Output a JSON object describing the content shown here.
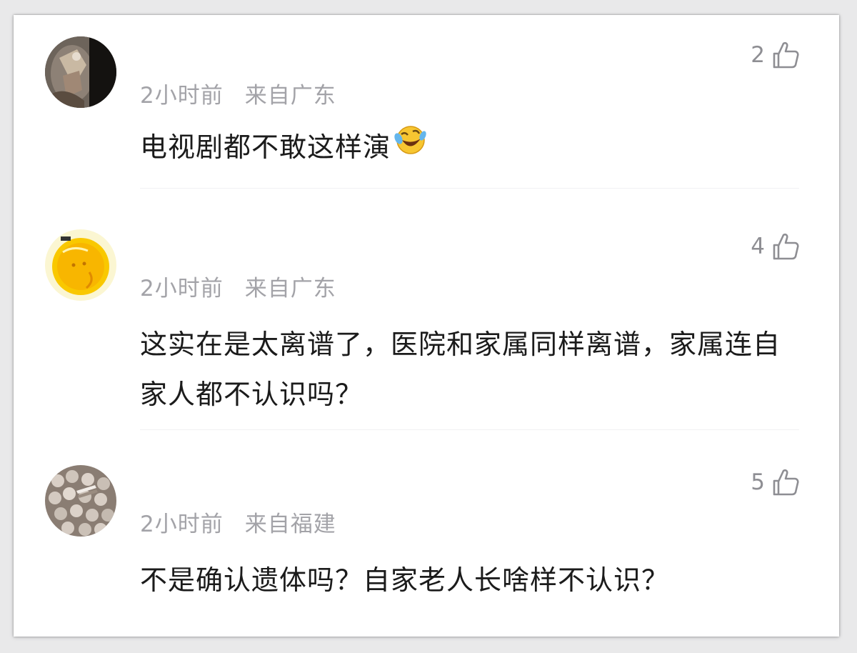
{
  "comments": [
    {
      "likes": "2",
      "time": "2小时前",
      "location": "来自广东",
      "text": "电视剧都不敢这样演",
      "emoji": "laughing-crying-emoji"
    },
    {
      "likes": "4",
      "time": "2小时前",
      "location": "来自广东",
      "text": "这实在是太离谱了，医院和家属同样离谱，家属连自家人都不认识吗？"
    },
    {
      "likes": "5",
      "time": "2小时前",
      "location": "来自福建",
      "text": "不是确认遗体吗？自家老人长啥样不认识？"
    }
  ],
  "icons": {
    "like": "thumbs-up-outline-icon"
  },
  "colors": {
    "meta_text": "#a3a3a8",
    "body_text": "#1b1b1b",
    "like_icon": "#8e8e93"
  }
}
